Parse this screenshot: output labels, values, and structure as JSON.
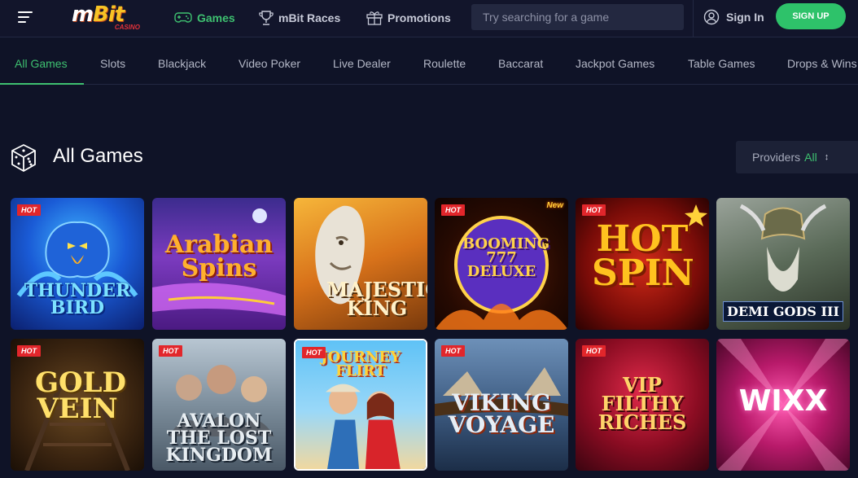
{
  "brand": {
    "logo_text": "mBit",
    "logo_sub": "CASINO"
  },
  "nav": {
    "games": "Games",
    "races": "mBit Races",
    "promotions": "Promotions",
    "search_placeholder": "Try searching for a game",
    "signin": "Sign In",
    "signup": "SIGN UP"
  },
  "tabs": [
    "All Games",
    "Slots",
    "Blackjack",
    "Video Poker",
    "Live Dealer",
    "Roulette",
    "Baccarat",
    "Jackpot Games",
    "Table Games",
    "Drops & Wins"
  ],
  "section": {
    "title": "All Games",
    "providers_label": "Providers",
    "providers_value": "All"
  },
  "badge_hot": "HOT",
  "badge_new": "New",
  "games": [
    {
      "title": "THUNDER BIRD",
      "hot": true
    },
    {
      "title": "Arabian Spins",
      "hot": false
    },
    {
      "title": "MAJESTIC KING",
      "hot": false
    },
    {
      "title": "BOOMING 777 DELUXE",
      "hot": true,
      "new": true
    },
    {
      "title": "HOT SPIN",
      "hot": true
    },
    {
      "title": "DEMI GODS III",
      "hot": false
    },
    {
      "title": "GOLD VEIN",
      "hot": true
    },
    {
      "title": "AVALON THE LOST KINGDOM",
      "hot": true
    },
    {
      "title": "JOURNEY FLIRT",
      "hot": true
    },
    {
      "title": "VIKING VOYAGE",
      "hot": true
    },
    {
      "title": "VIP FILTHY RICHES",
      "hot": true
    },
    {
      "title": "WIXX",
      "hot": false
    }
  ],
  "colors": {
    "accent": "#3ec070",
    "background": "#0f1327",
    "hot_badge": "#e2262b"
  }
}
